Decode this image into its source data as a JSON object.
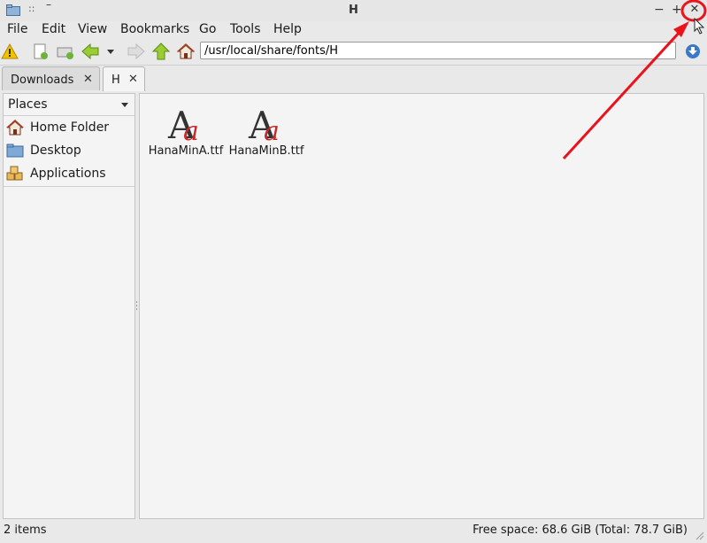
{
  "window": {
    "title": "H",
    "menu_dots": "::",
    "dash": "–",
    "min_label": "−",
    "max_label": "+",
    "close_label": "✕"
  },
  "menu": {
    "items": [
      "File",
      "Edit",
      "View",
      "Bookmarks",
      "Go",
      "Tools",
      "Help"
    ]
  },
  "toolbar": {
    "icons": [
      "warning-icon",
      "new-tab-icon",
      "new-window-icon",
      "back-icon",
      "history-dropdown-icon",
      "forward-icon",
      "up-icon",
      "home-icon",
      "go-icon"
    ],
    "path": "/usr/local/share/fonts/H"
  },
  "tabs": [
    {
      "label": "Downloads",
      "close": "✕",
      "active": false
    },
    {
      "label": "H",
      "close": "✕",
      "active": true
    }
  ],
  "sidebar": {
    "header": "Places",
    "items": [
      {
        "label": "Home Folder",
        "icon": "home-folder-icon"
      },
      {
        "label": "Desktop",
        "icon": "desktop-icon"
      },
      {
        "label": "Applications",
        "icon": "applications-icon"
      }
    ]
  },
  "files": [
    {
      "name": "HanaMinA.ttf",
      "icon": "font-file-icon"
    },
    {
      "name": "HanaMinB.ttf",
      "icon": "font-file-icon"
    }
  ],
  "status": {
    "items": "2 items",
    "free_space": "Free space: 68.6 GiB (Total: 78.7 GiB)"
  },
  "colors": {
    "annotation": "#e8131b",
    "accent_green": "#7fbf2a",
    "home_roof": "#a0402a"
  }
}
